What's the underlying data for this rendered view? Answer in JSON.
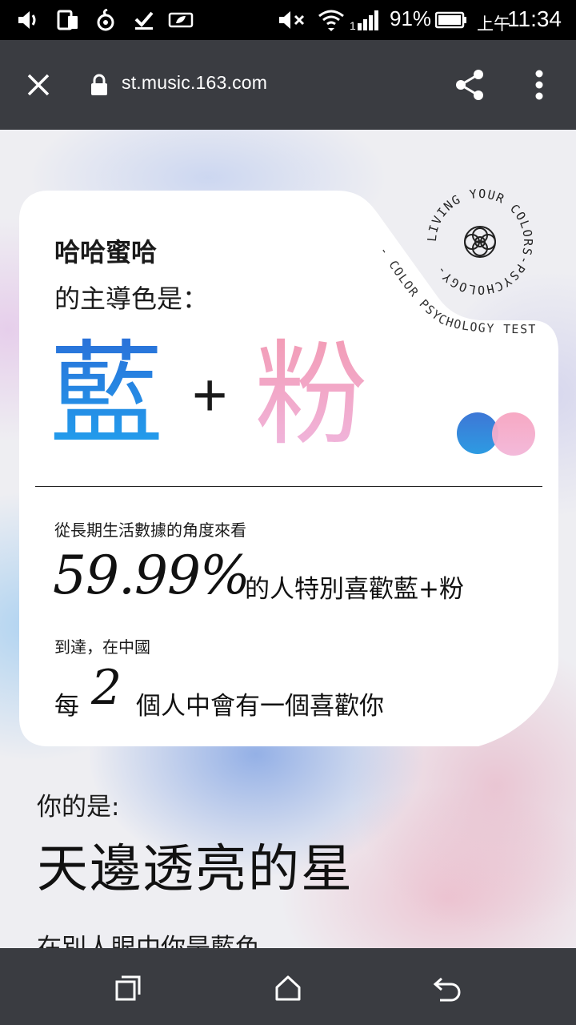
{
  "status_bar": {
    "battery_percent": "91%",
    "ampm": "上午",
    "time": "11:34",
    "icons": [
      "volume-icon",
      "phone-screen-icon",
      "app-icon",
      "checkmark-icon",
      "leaf-battery-icon",
      "mute-icon",
      "wifi-icon",
      "signal-icon",
      "battery-icon"
    ]
  },
  "browser": {
    "url": "st.music.163.com",
    "close_icon": "close-icon",
    "lock_icon": "lock-icon",
    "share_icon": "share-icon",
    "menu_icon": "more-vert-icon"
  },
  "card": {
    "user_name": "哈哈蜜哈",
    "subtitle": "的主導色是：",
    "color_main": "藍",
    "plus": "+",
    "color_second": "粉",
    "badge_ring_text": "LIVING YOUR COLORS-PSYCHOLOGY-",
    "badge_arc_text": "- COLOR PSYCHOLOGY TEST -",
    "perspective": "從長期生活數據的角度來看",
    "percent": "59.99%",
    "percent_text": "的人特別喜歡藍+粉",
    "reach": "到達，在中國",
    "every_prefix": "每",
    "every_num": "2",
    "every_text": "個人中會有一個喜歡你",
    "colors": {
      "blue": "#2a6fd8",
      "pink": "#f39bb4"
    }
  },
  "result": {
    "you_are": "你的是:",
    "title": "天邊透亮的星",
    "next_line": "在別人眼中你是藍色"
  },
  "navbar": {
    "icons": [
      "recent-apps-icon",
      "home-icon",
      "back-icon"
    ]
  }
}
